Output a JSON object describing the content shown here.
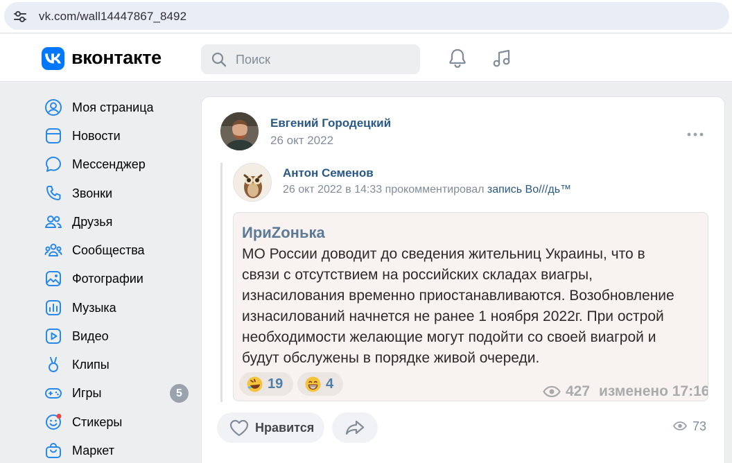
{
  "browser": {
    "url": "vk.com/wall14447867_8492"
  },
  "header": {
    "brand": "вконтакте",
    "search_placeholder": "Поиск"
  },
  "sidebar": {
    "items": [
      {
        "label": "Моя страница",
        "icon": "user-circle-icon"
      },
      {
        "label": "Новости",
        "icon": "news-icon"
      },
      {
        "label": "Мессенджер",
        "icon": "message-icon"
      },
      {
        "label": "Звонки",
        "icon": "phone-icon"
      },
      {
        "label": "Друзья",
        "icon": "friends-icon"
      },
      {
        "label": "Сообщества",
        "icon": "communities-icon"
      },
      {
        "label": "Фотографии",
        "icon": "photo-icon"
      },
      {
        "label": "Музыка",
        "icon": "music-chart-icon"
      },
      {
        "label": "Видео",
        "icon": "video-icon"
      },
      {
        "label": "Клипы",
        "icon": "clips-icon"
      },
      {
        "label": "Игры",
        "icon": "gamepad-icon",
        "badge": "5"
      },
      {
        "label": "Стикеры",
        "icon": "sticker-icon"
      },
      {
        "label": "Маркет",
        "icon": "market-icon"
      }
    ]
  },
  "post": {
    "author": "Евгений Городецкий",
    "date": "26 окт 2022",
    "repost": {
      "author": "Антон Семенов",
      "meta": "26 окт 2022 в 14:33 прокомментировал",
      "link": "запись Во///дь™"
    },
    "embed": {
      "title": "ИриZонька",
      "text": "МО России доводит до сведения жительниц Украины, что в\nсвязи с отсутствием на российских складах виагры,\nизнасилования временно приостанавливаются.  Возобновление\nизнасилований начнется не ранее  1 ноября 2022г.  При острой\nнеобходимости желающие могут подойти со своей виагрой и\nбудут обслужены  в порядке живой очереди.",
      "reactions": [
        {
          "emoji": "rofl-emoji-icon",
          "count": "19"
        },
        {
          "emoji": "grin-emoji-icon",
          "count": "4"
        }
      ],
      "views": "427",
      "edited": "изменено 17:16"
    },
    "like_label": "Нравится",
    "views": "73"
  },
  "colors": {
    "accent": "#0077ff",
    "link": "#2a5885",
    "muted": "#818c99",
    "background": "#edeef0"
  }
}
